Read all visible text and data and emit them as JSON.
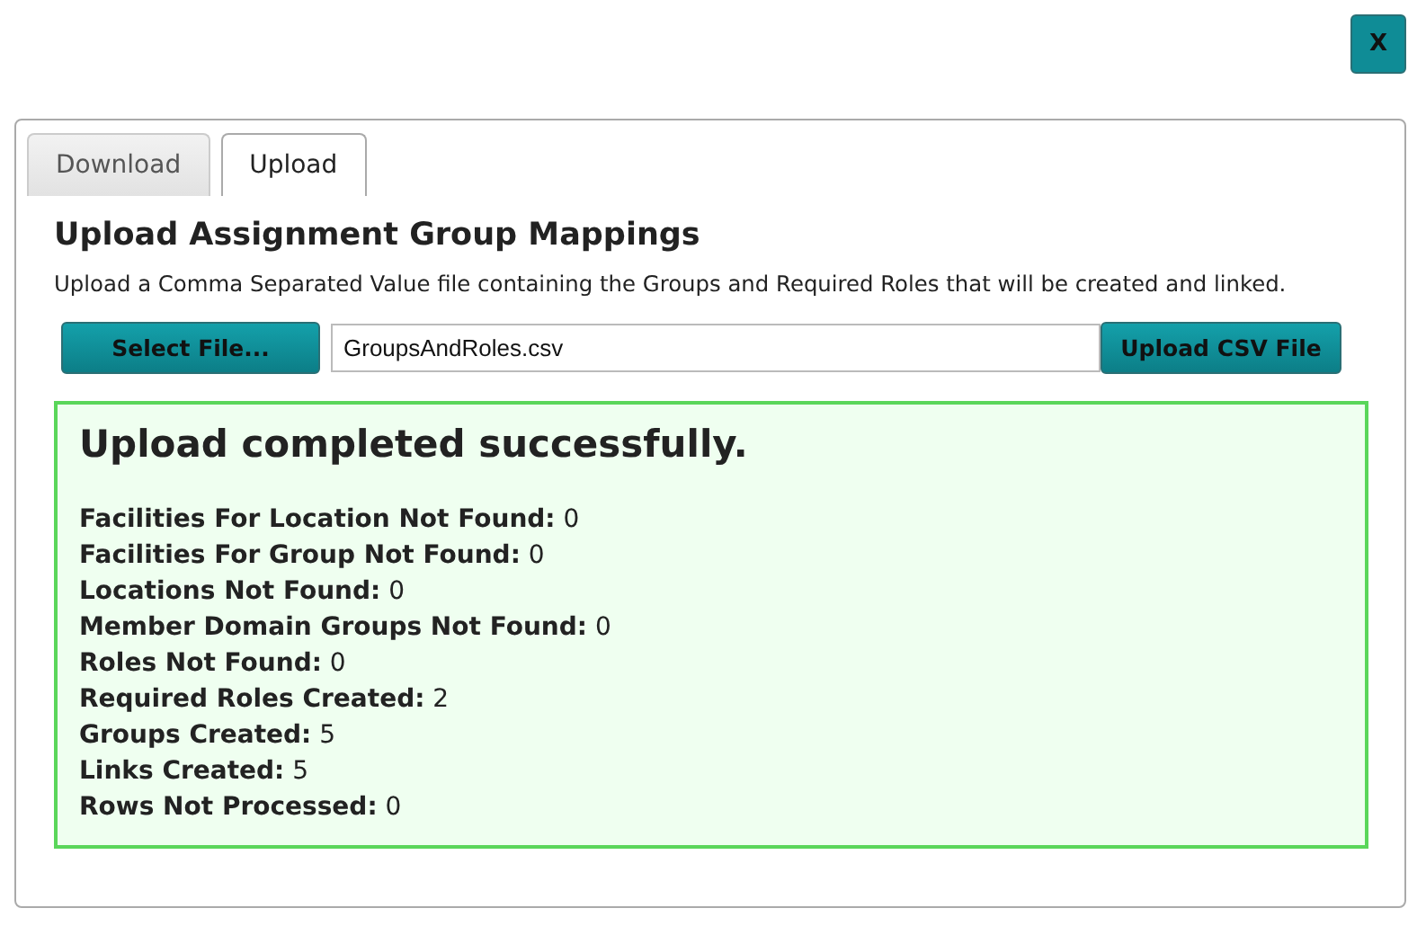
{
  "close_button": "X",
  "tabs": [
    {
      "label": "Download",
      "selected": false
    },
    {
      "label": "Upload",
      "selected": true
    }
  ],
  "heading": "Upload Assignment Group Mappings",
  "description": "Upload a Comma Separated Value file containing the Groups and Required Roles that will be created and linked.",
  "select_button": "Select File...",
  "file_field": {
    "value": "GroupsAndRoles.csv"
  },
  "upload_button": "Upload CSV File",
  "result": {
    "success": true,
    "title": "Upload completed successfully.",
    "lines": [
      "**Facilities For Location Not Found:** 0",
      "**Facilities For Group Not Found:** 0",
      "**Locations Not Found:** 0",
      "**Member Domain Groups Not Found:** 0",
      "**Roles Not Found:** 0",
      "**Required Roles Created:** 2",
      "**Groups Created:** 5",
      "**Links Created:** 5",
      "**Rows Not Processed:** 0"
    ]
  }
}
